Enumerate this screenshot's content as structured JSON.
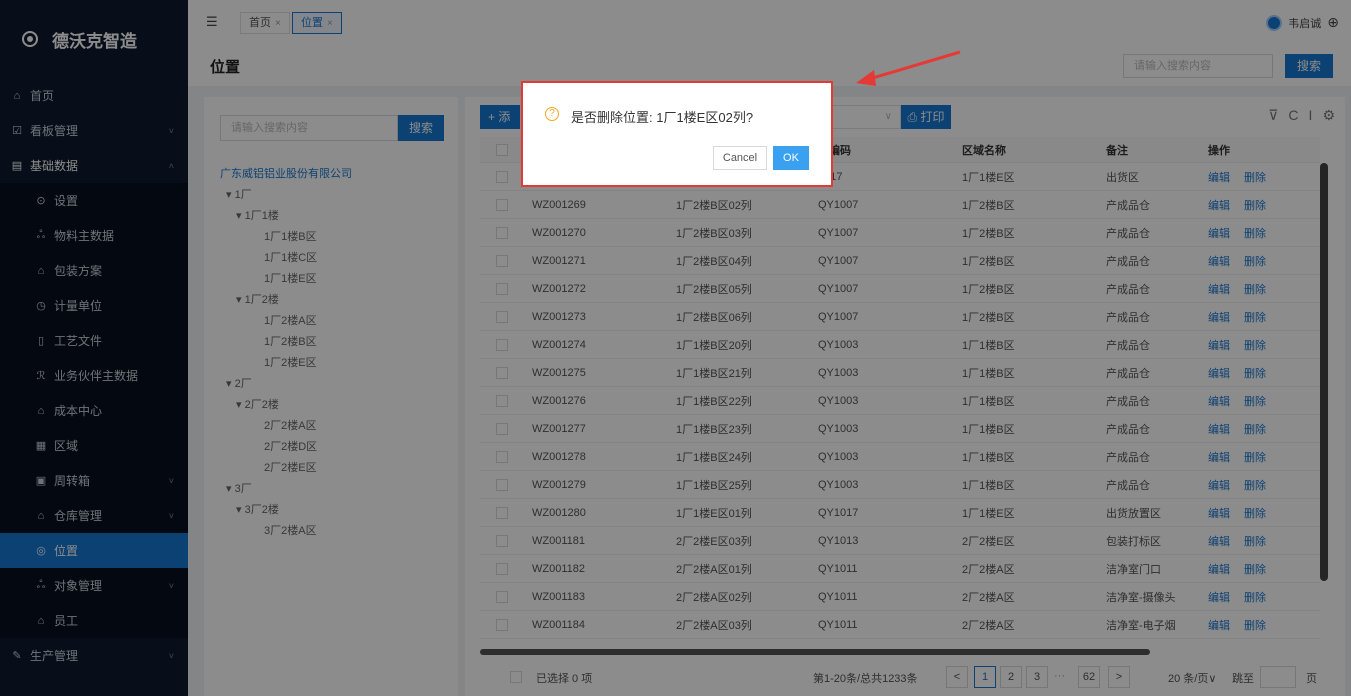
{
  "sidebar": {
    "brand": "德沃克智造",
    "items": [
      {
        "icon": "⌂",
        "label": "首页",
        "chev": "",
        "cls": ""
      },
      {
        "icon": "☑",
        "label": "看板管理",
        "chev": "˅",
        "cls": ""
      },
      {
        "icon": "▤",
        "label": "基础数据",
        "chev": "˄",
        "cls": "open"
      },
      {
        "icon": "⊙",
        "label": "设置",
        "chev": "",
        "cls": "sub"
      },
      {
        "icon": "ஃ",
        "label": "物料主数据",
        "chev": "",
        "cls": "sub"
      },
      {
        "icon": "⌂",
        "label": "包装方案",
        "chev": "",
        "cls": "sub"
      },
      {
        "icon": "◷",
        "label": "计量单位",
        "chev": "",
        "cls": "sub"
      },
      {
        "icon": "▯",
        "label": "工艺文件",
        "chev": "",
        "cls": "sub"
      },
      {
        "icon": "ℛ",
        "label": "业务伙伴主数据",
        "chev": "",
        "cls": "sub"
      },
      {
        "icon": "⌂",
        "label": "成本中心",
        "chev": "",
        "cls": "sub"
      },
      {
        "icon": "▦",
        "label": "区域",
        "chev": "",
        "cls": "sub"
      },
      {
        "icon": "▣",
        "label": "周转箱",
        "chev": "˅",
        "cls": "sub"
      },
      {
        "icon": "⌂",
        "label": "仓库管理",
        "chev": "˅",
        "cls": "sub"
      },
      {
        "icon": "◎",
        "label": "位置",
        "chev": "",
        "cls": "sub active"
      },
      {
        "icon": "ஃ",
        "label": "对象管理",
        "chev": "˅",
        "cls": "sub"
      },
      {
        "icon": "⌂",
        "label": "员工",
        "chev": "",
        "cls": "sub"
      },
      {
        "icon": "✎",
        "label": "生产管理",
        "chev": "˅",
        "cls": ""
      }
    ]
  },
  "topbar": {
    "fold_icon": "☰",
    "tabs": [
      {
        "label": "首页",
        "close": "×"
      },
      {
        "label": "位置",
        "close": "×"
      }
    ],
    "user_name": "韦启诚",
    "globe_icon": "⊕"
  },
  "page": {
    "title": "位置",
    "search_placeholder": "请输入搜索内容",
    "search_button": "搜索"
  },
  "tree": {
    "search_placeholder": "请输入搜索内容",
    "search_button": "搜索",
    "nodes": [
      {
        "label": "广东威铝铝业股份有限公司",
        "level": 0
      },
      {
        "label": "▾ 1厂",
        "level": 1
      },
      {
        "label": "▾ 1厂1楼",
        "level": 2
      },
      {
        "label": "1厂1楼B区",
        "level": 3
      },
      {
        "label": "1厂1楼C区",
        "level": 3
      },
      {
        "label": "1厂1楼E区",
        "level": 3
      },
      {
        "label": "▾ 1厂2楼",
        "level": 2
      },
      {
        "label": "1厂2楼A区",
        "level": 3
      },
      {
        "label": "1厂2楼B区",
        "level": 3
      },
      {
        "label": "1厂2楼E区",
        "level": 3
      },
      {
        "label": "▾ 2厂",
        "level": 1
      },
      {
        "label": "▾ 2厂2楼",
        "level": 2
      },
      {
        "label": "2厂2楼A区",
        "level": 3
      },
      {
        "label": "2厂2楼D区",
        "level": 3
      },
      {
        "label": "2厂2楼E区",
        "level": 3
      },
      {
        "label": "▾ 3厂",
        "level": 1
      },
      {
        "label": "▾ 3厂2楼",
        "level": 2
      },
      {
        "label": "3厂2楼A区",
        "level": 3
      }
    ]
  },
  "toolbar": {
    "add_label": "+ 添",
    "select_arrow": "∨",
    "print_label": "⎙ 打印",
    "tool_icons": [
      "⊽",
      "C",
      "I",
      "⚙"
    ]
  },
  "table": {
    "headers": [
      "",
      "",
      "",
      "域编码",
      "区域名称",
      "备注",
      "操作"
    ],
    "rows": [
      {
        "code": "",
        "name": "",
        "area_code": "1017",
        "area_name": "1厂1楼E区",
        "note": "出货区"
      },
      {
        "code": "WZ001269",
        "name": "1厂2楼B区02列",
        "area_code": "QY1007",
        "area_name": "1厂2楼B区",
        "note": "产成品仓"
      },
      {
        "code": "WZ001270",
        "name": "1厂2楼B区03列",
        "area_code": "QY1007",
        "area_name": "1厂2楼B区",
        "note": "产成品仓"
      },
      {
        "code": "WZ001271",
        "name": "1厂2楼B区04列",
        "area_code": "QY1007",
        "area_name": "1厂2楼B区",
        "note": "产成品仓"
      },
      {
        "code": "WZ001272",
        "name": "1厂2楼B区05列",
        "area_code": "QY1007",
        "area_name": "1厂2楼B区",
        "note": "产成品仓"
      },
      {
        "code": "WZ001273",
        "name": "1厂2楼B区06列",
        "area_code": "QY1007",
        "area_name": "1厂2楼B区",
        "note": "产成品仓"
      },
      {
        "code": "WZ001274",
        "name": "1厂1楼B区20列",
        "area_code": "QY1003",
        "area_name": "1厂1楼B区",
        "note": "产成品仓"
      },
      {
        "code": "WZ001275",
        "name": "1厂1楼B区21列",
        "area_code": "QY1003",
        "area_name": "1厂1楼B区",
        "note": "产成品仓"
      },
      {
        "code": "WZ001276",
        "name": "1厂1楼B区22列",
        "area_code": "QY1003",
        "area_name": "1厂1楼B区",
        "note": "产成品仓"
      },
      {
        "code": "WZ001277",
        "name": "1厂1楼B区23列",
        "area_code": "QY1003",
        "area_name": "1厂1楼B区",
        "note": "产成品仓"
      },
      {
        "code": "WZ001278",
        "name": "1厂1楼B区24列",
        "area_code": "QY1003",
        "area_name": "1厂1楼B区",
        "note": "产成品仓"
      },
      {
        "code": "WZ001279",
        "name": "1厂1楼B区25列",
        "area_code": "QY1003",
        "area_name": "1厂1楼B区",
        "note": "产成品仓"
      },
      {
        "code": "WZ001280",
        "name": "1厂1楼E区01列",
        "area_code": "QY1017",
        "area_name": "1厂1楼E区",
        "note": "出货放置区"
      },
      {
        "code": "WZ001181",
        "name": "2厂2楼E区03列",
        "area_code": "QY1013",
        "area_name": "2厂2楼E区",
        "note": "包装打标区"
      },
      {
        "code": "WZ001182",
        "name": "2厂2楼A区01列",
        "area_code": "QY1011",
        "area_name": "2厂2楼A区",
        "note": "洁净室门口"
      },
      {
        "code": "WZ001183",
        "name": "2厂2楼A区02列",
        "area_code": "QY1011",
        "area_name": "2厂2楼A区",
        "note": "洁净室-摄像头"
      },
      {
        "code": "WZ001184",
        "name": "2厂2楼A区03列",
        "area_code": "QY1011",
        "area_name": "2厂2楼A区",
        "note": "洁净室-电子烟"
      }
    ],
    "edit_label": "编辑",
    "delete_label": "删除"
  },
  "footer": {
    "selected": "已选择 0 项",
    "summary": "第1-20条/总共1233条",
    "prev": "<",
    "pages": [
      "1",
      "2",
      "3",
      "···",
      "62"
    ],
    "next": ">",
    "page_size": "20 条/页∨",
    "jump_label": "跳至",
    "page_suffix": "页"
  },
  "modal": {
    "icon": "?",
    "message": "是否删除位置: 1厂1楼E区02列?",
    "cancel": "Cancel",
    "ok": "OK"
  },
  "colors": {
    "primary": "#1677d2",
    "annotation_red": "#e53935"
  }
}
